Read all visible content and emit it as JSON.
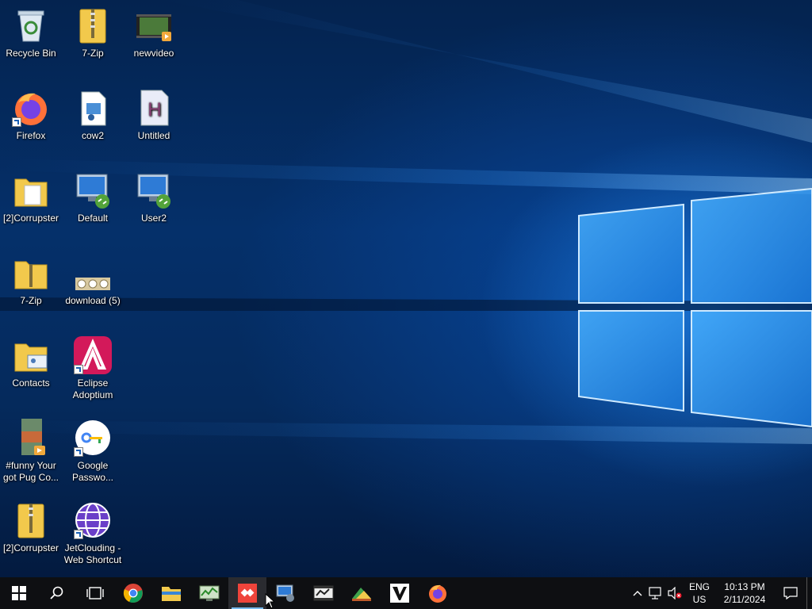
{
  "desktop": {
    "icons": [
      {
        "label": "Recycle Bin",
        "icon": "recycle-bin-icon"
      },
      {
        "label": "7-Zip",
        "icon": "zip-folder-icon"
      },
      {
        "label": "newvideo",
        "icon": "video-file-icon"
      },
      {
        "label": "Firefox",
        "icon": "firefox-icon"
      },
      {
        "label": "cow2",
        "icon": "media-file-icon"
      },
      {
        "label": "Untitled",
        "icon": "h-document-icon"
      },
      {
        "label": "[2]Corrupster",
        "icon": "folder-icon"
      },
      {
        "label": "Default",
        "icon": "remote-desktop-icon"
      },
      {
        "label": "User2",
        "icon": "remote-desktop-icon"
      },
      {
        "label": "7-Zip",
        "icon": "zip-folder-icon"
      },
      {
        "label": "download (5)",
        "icon": "image-thumbnail-icon"
      },
      {
        "label": "Contacts",
        "icon": "contacts-folder-icon"
      },
      {
        "label": "Eclipse\nAdoptium",
        "icon": "eclipse-adoptium-icon"
      },
      {
        "label": "#funny Your\ngot Pug Co...",
        "icon": "video-thumbnail-icon"
      },
      {
        "label": "Google\nPasswo...",
        "icon": "google-passwords-icon"
      },
      {
        "label": "[2]Corrupster",
        "icon": "zip-folder-icon"
      },
      {
        "label": "JetClouding -\nWeb Shortcut",
        "icon": "globe-icon"
      }
    ]
  },
  "taskbar": {
    "pinned": [
      {
        "name": "start",
        "icon": "windows-start-icon"
      },
      {
        "name": "search",
        "icon": "search-icon"
      },
      {
        "name": "task-view",
        "icon": "task-view-icon"
      },
      {
        "name": "chrome",
        "icon": "chrome-icon"
      },
      {
        "name": "file-explorer",
        "icon": "file-explorer-icon"
      },
      {
        "name": "task-manager",
        "icon": "task-manager-icon"
      },
      {
        "name": "anydesk",
        "icon": "anydesk-icon"
      },
      {
        "name": "remote-desktop",
        "icon": "remote-desktop-icon"
      },
      {
        "name": "video-editor",
        "icon": "video-editor-icon"
      },
      {
        "name": "photo-app",
        "icon": "photo-app-icon"
      },
      {
        "name": "vim",
        "icon": "vim-icon"
      },
      {
        "name": "firefox",
        "icon": "firefox-icon"
      }
    ],
    "tray": {
      "lang_top": "ENG",
      "lang_bottom": "US",
      "time": "10:13 PM",
      "date": "2/11/2024"
    }
  },
  "colors": {
    "taskbar_bg": "#0e0f12",
    "accent": "#76b9ed"
  }
}
